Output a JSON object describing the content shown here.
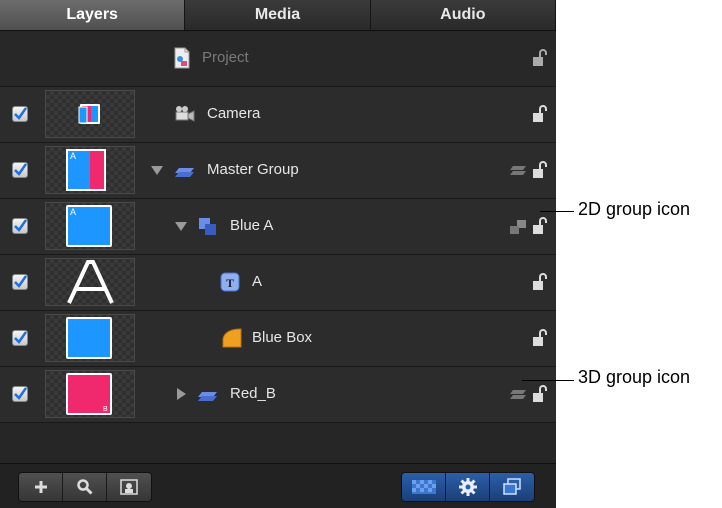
{
  "tabs": [
    {
      "label": "Layers",
      "active": true
    },
    {
      "label": "Media",
      "active": false
    },
    {
      "label": "Audio",
      "active": false
    }
  ],
  "layers": [
    {
      "name": "Project",
      "checked": null,
      "thumb": null,
      "group_icon": null
    },
    {
      "name": "Camera",
      "checked": true,
      "thumb": "camera",
      "group_icon": null
    },
    {
      "name": "Master Group",
      "checked": true,
      "thumb": "master",
      "expanded": true,
      "group_icon": "3d"
    },
    {
      "name": "Blue A",
      "checked": true,
      "thumb": "blue-a",
      "expanded": true,
      "group_icon": "2d"
    },
    {
      "name": "A",
      "checked": true,
      "thumb": "letter-a",
      "group_icon": null
    },
    {
      "name": "Blue Box",
      "checked": true,
      "thumb": "blue-box",
      "group_icon": null
    },
    {
      "name": "Red_B",
      "checked": true,
      "thumb": "red-b",
      "expanded": false,
      "group_icon": "3d"
    }
  ],
  "bottom_toolbar": {
    "left_icons": [
      "add-icon",
      "search-icon",
      "mask-icon"
    ],
    "right_icons": [
      "checkerboard-icon",
      "gear-icon",
      "layers-icon"
    ]
  },
  "callouts": {
    "group_2d": "2D group icon",
    "group_3d": "3D group icon"
  },
  "colors": {
    "panel_bg": "#262626",
    "row_bg": "#2c2c2c",
    "accent_blue": "#1e96ff",
    "accent_red": "#f0286e",
    "toolbar_blue": "#2c5fa8"
  }
}
